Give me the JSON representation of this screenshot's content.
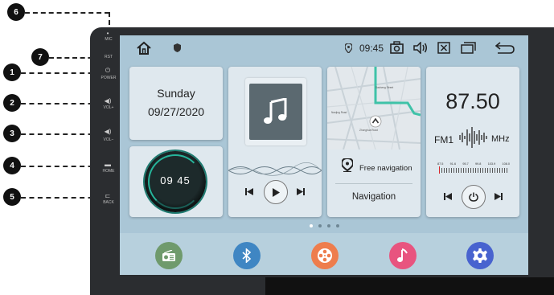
{
  "callouts": [
    "1",
    "2",
    "3",
    "4",
    "5",
    "6",
    "7"
  ],
  "side_buttons": {
    "mic": "MIC",
    "rst": "RST",
    "power": "POWER",
    "vol_up": "VOL+",
    "vol_down": "VOL−",
    "home": "HOME",
    "back": "BACK"
  },
  "status": {
    "time": "09:45"
  },
  "date_card": {
    "day": "Sunday",
    "date": "09/27/2020"
  },
  "clock_card": {
    "time": "09 45"
  },
  "nav_card": {
    "free_nav": "Free navigation",
    "title": "Navigation",
    "map_labels": [
      "Dasheng Street",
      "Nanjing Road",
      "Zhonghua Road"
    ]
  },
  "radio_card": {
    "frequency": "87.50",
    "band": "FM1",
    "unit": "MHz",
    "scale": [
      "87.5",
      "91.6",
      "95.7",
      "99.8",
      "103.9",
      "108.0"
    ]
  },
  "dock_apps": [
    {
      "name": "radio",
      "color": "#6f9a6c"
    },
    {
      "name": "bluetooth",
      "color": "#3f86c3"
    },
    {
      "name": "video",
      "color": "#ee7d4d"
    },
    {
      "name": "music",
      "color": "#e8547f"
    },
    {
      "name": "settings",
      "color": "#4863cf"
    }
  ]
}
